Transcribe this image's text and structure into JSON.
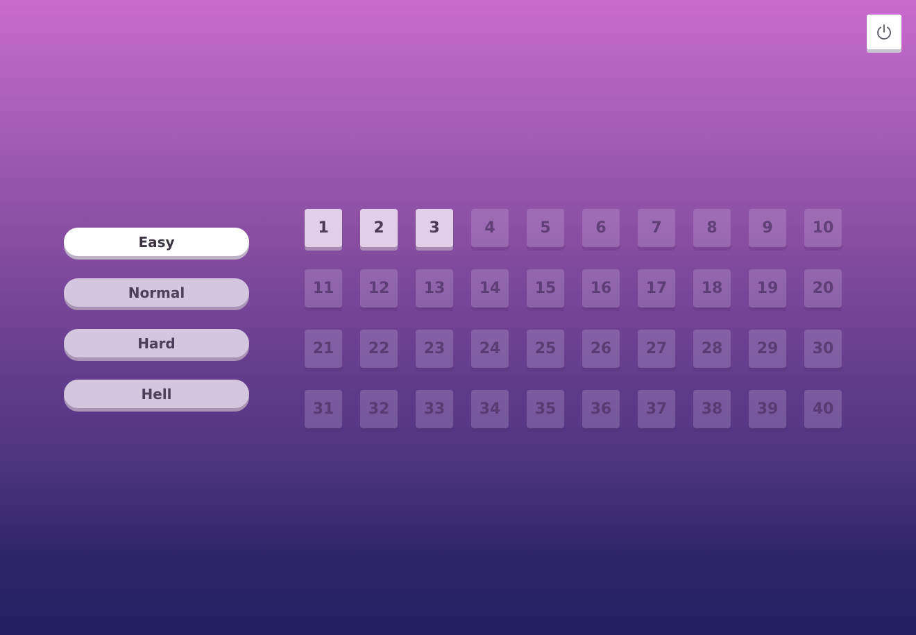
{
  "power_button": {
    "icon": "power-icon"
  },
  "difficulty": [
    {
      "label": "Easy",
      "active": true
    },
    {
      "label": "Normal",
      "active": false
    },
    {
      "label": "Hard",
      "active": false
    },
    {
      "label": "Hell",
      "active": false
    }
  ],
  "levels": [
    {
      "label": "1",
      "unlocked": true
    },
    {
      "label": "2",
      "unlocked": true
    },
    {
      "label": "3",
      "unlocked": true
    },
    {
      "label": "4",
      "unlocked": false
    },
    {
      "label": "5",
      "unlocked": false
    },
    {
      "label": "6",
      "unlocked": false
    },
    {
      "label": "7",
      "unlocked": false
    },
    {
      "label": "8",
      "unlocked": false
    },
    {
      "label": "9",
      "unlocked": false
    },
    {
      "label": "10",
      "unlocked": false
    },
    {
      "label": "11",
      "unlocked": false
    },
    {
      "label": "12",
      "unlocked": false
    },
    {
      "label": "13",
      "unlocked": false
    },
    {
      "label": "14",
      "unlocked": false
    },
    {
      "label": "15",
      "unlocked": false
    },
    {
      "label": "16",
      "unlocked": false
    },
    {
      "label": "17",
      "unlocked": false
    },
    {
      "label": "18",
      "unlocked": false
    },
    {
      "label": "19",
      "unlocked": false
    },
    {
      "label": "20",
      "unlocked": false
    },
    {
      "label": "21",
      "unlocked": false
    },
    {
      "label": "22",
      "unlocked": false
    },
    {
      "label": "23",
      "unlocked": false
    },
    {
      "label": "24",
      "unlocked": false
    },
    {
      "label": "25",
      "unlocked": false
    },
    {
      "label": "26",
      "unlocked": false
    },
    {
      "label": "27",
      "unlocked": false
    },
    {
      "label": "28",
      "unlocked": false
    },
    {
      "label": "29",
      "unlocked": false
    },
    {
      "label": "30",
      "unlocked": false
    },
    {
      "label": "31",
      "unlocked": false
    },
    {
      "label": "32",
      "unlocked": false
    },
    {
      "label": "33",
      "unlocked": false
    },
    {
      "label": "34",
      "unlocked": false
    },
    {
      "label": "35",
      "unlocked": false
    },
    {
      "label": "36",
      "unlocked": false
    },
    {
      "label": "37",
      "unlocked": false
    },
    {
      "label": "38",
      "unlocked": false
    },
    {
      "label": "39",
      "unlocked": false
    },
    {
      "label": "40",
      "unlocked": false
    }
  ]
}
